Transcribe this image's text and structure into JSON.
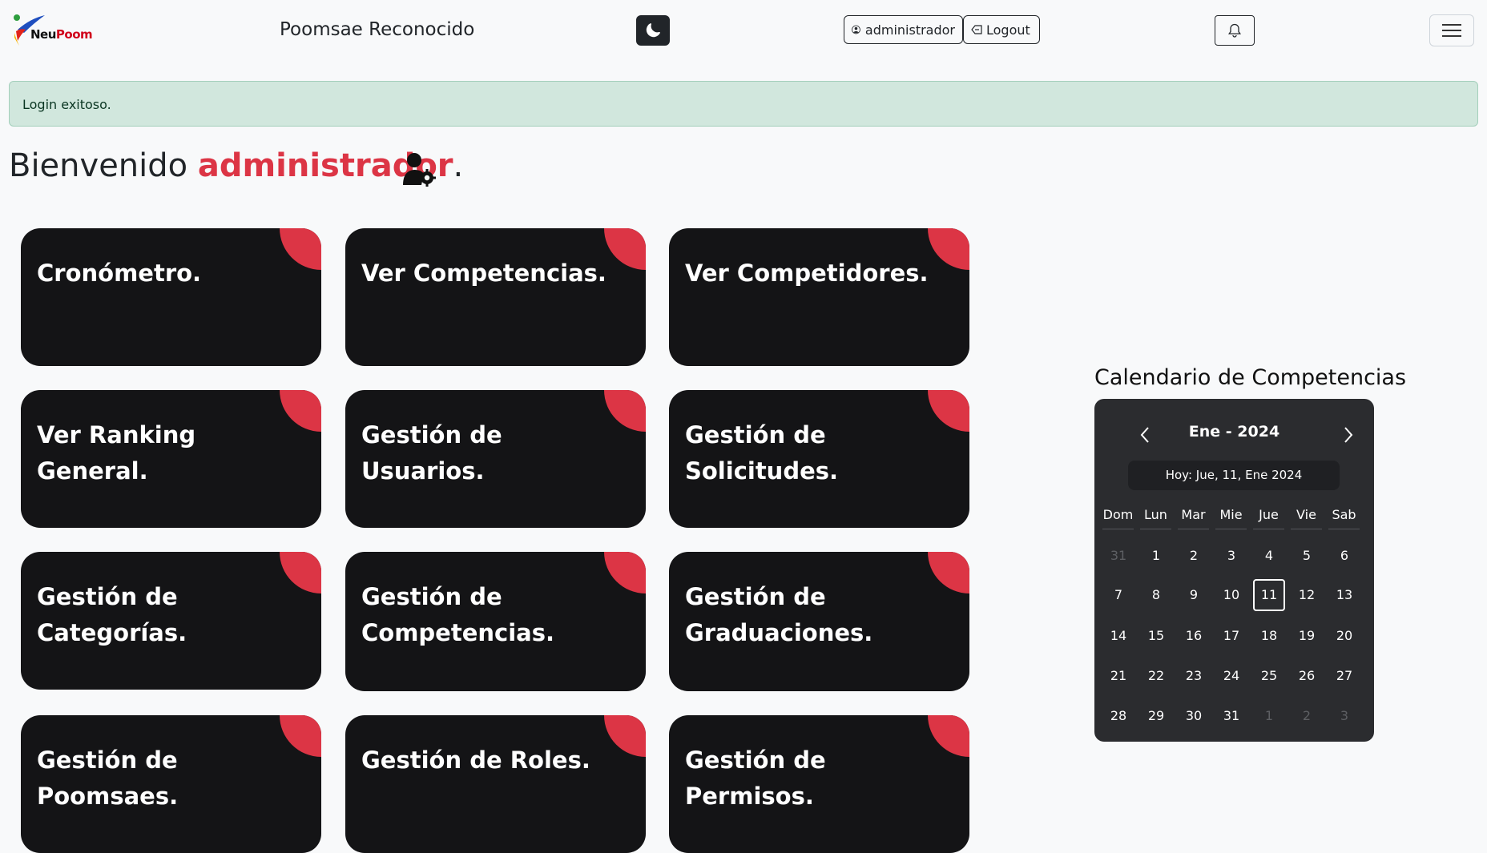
{
  "navbar": {
    "logo_text_1": "Neu",
    "logo_text_2": "Poom",
    "brand": "Poomsae Reconocido",
    "theme_icon": "moon-icon",
    "user_label": "administrador",
    "logout_label": "Logout",
    "bell_icon": "bell-icon",
    "menu_icon": "hamburger-icon"
  },
  "alert": {
    "message": "Login exitoso."
  },
  "welcome": {
    "prefix": "Bienvenido ",
    "username": "administrador",
    "suffix": "."
  },
  "cards": [
    "Cronómetro.",
    "Ver Competencias.",
    "Ver Competidores.",
    "Ver Ranking General.",
    "Gestión de Usuarios.",
    "Gestión de Solicitudes.",
    "Gestión de Categorías.",
    "Gestión de Competencias.",
    "Gestión de Graduaciones.",
    "Gestión de Poomsaes.",
    "Gestión de Roles.",
    "Gestión de Permisos."
  ],
  "calendar": {
    "heading": "Calendario de Competencias",
    "month_label": "Ene - 2024",
    "today_label": "Hoy: Jue, 11, Ene 2024",
    "weekdays": [
      "Dom",
      "Lun",
      "Mar",
      "Mie",
      "Jue",
      "Vie",
      "Sab"
    ],
    "weeks": [
      [
        "31",
        "1",
        "2",
        "3",
        "4",
        "5",
        "6"
      ],
      [
        "7",
        "8",
        "9",
        "10",
        "11",
        "12",
        "13"
      ],
      [
        "14",
        "15",
        "16",
        "17",
        "18",
        "19",
        "20"
      ],
      [
        "21",
        "22",
        "23",
        "24",
        "25",
        "26",
        "27"
      ],
      [
        "28",
        "29",
        "30",
        "31",
        "1",
        "2",
        "3"
      ]
    ],
    "today_day": "11"
  },
  "colors": {
    "accent": "#dc3545",
    "card_bg": "#141416",
    "calendar_bg": "#2b2c2f",
    "alert_bg": "#d1e7dd"
  }
}
